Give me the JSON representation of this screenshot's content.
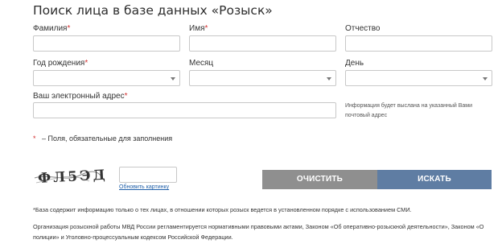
{
  "title": "Поиск лица в базе данных «Розыск»",
  "fields": {
    "surname": {
      "label": "Фамилия",
      "required_mark": "*",
      "value": ""
    },
    "name": {
      "label": "Имя",
      "required_mark": "*",
      "value": ""
    },
    "patronymic": {
      "label": "Отчество",
      "value": ""
    },
    "birth_year": {
      "label": "Год рождения",
      "required_mark": "*",
      "value": ""
    },
    "month": {
      "label": "Месяц",
      "value": ""
    },
    "day": {
      "label": "День",
      "value": ""
    },
    "email": {
      "label": "Ваш электронный адрес",
      "required_mark": "*",
      "value": ""
    }
  },
  "email_hint": "Информация будет выслана на указанный Вами почтовый адрес",
  "required_note": {
    "mark": "*",
    "text": "– Поля, обязательные для заполнения"
  },
  "captcha": {
    "image_text": "ФЛ5ЭД",
    "input_value": "",
    "refresh_label": "Обновить картинку"
  },
  "buttons": {
    "clear": "ОЧИСТИТЬ",
    "search": "ИСКАТЬ"
  },
  "footnote": "*База содержит информацию только о тех лицах, в отношении которых розыск ведется в установленном порядке с использованием СМИ.",
  "legal_text": "Организация розыскной работы МВД России регламентируется нормативными правовыми актами, Законом «Об оперативно-розыскной деятельности», Законом «О полиции» и Уголовно-процессуальным кодексом Российской Федерации."
}
